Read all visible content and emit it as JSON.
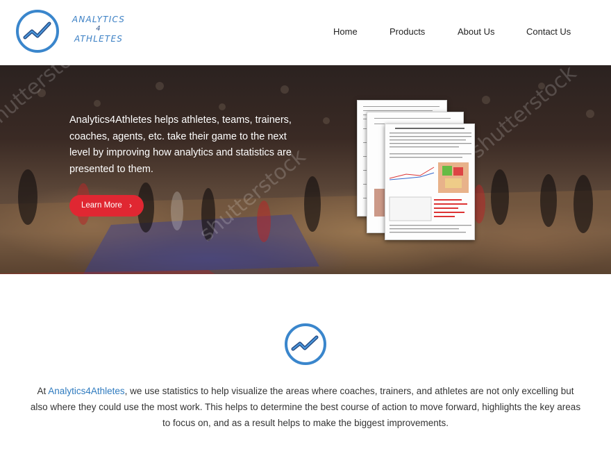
{
  "header": {
    "logo_line1": "ANALYTICS",
    "logo_line2": "4",
    "logo_line3": "ATHLETES",
    "nav": [
      {
        "label": "Home"
      },
      {
        "label": "Products"
      },
      {
        "label": "About Us"
      },
      {
        "label": "Contact Us"
      }
    ]
  },
  "hero": {
    "text": "Analytics4Athletes helps athletes, teams, trainers, coaches, agents, etc. take their game to the next level by improving how analytics and statistics are presented to them.",
    "button_label": "Learn More",
    "button_icon": "chevron-right-icon",
    "watermark": "shutterstock"
  },
  "about": {
    "prefix": "At ",
    "brand": "Analytics4Athletes",
    "body": ", we use statistics to help visualize the areas where coaches, trainers, and athletes are not only excelling but also where they could use the most work. This helps to determine the best course of action to move forward, highlights the key areas to focus on, and as a result helps to make the biggest improvements."
  },
  "colors": {
    "brand_blue": "#3a7fc4",
    "accent_red": "#e02732"
  }
}
